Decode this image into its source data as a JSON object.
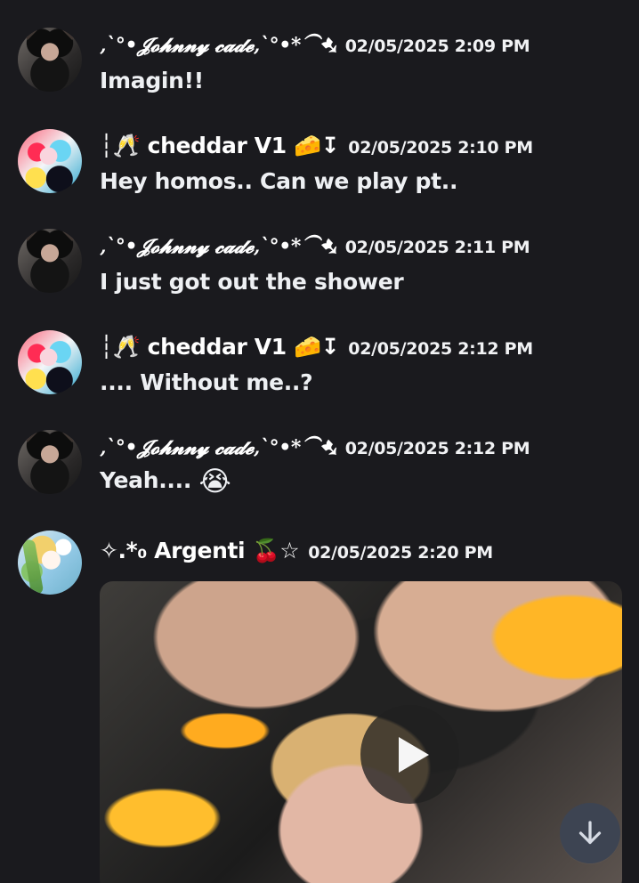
{
  "messages": [
    {
      "username": "‚`°•𝓙𝓸𝓱𝓷𝓷𝔂 𝓬𝓪𝓭𝓮‚`°•*⁀➷",
      "timestamp": "02/05/2025 2:09 PM",
      "text": "Imagin!!",
      "emoji": ""
    },
    {
      "username": "┆🥂 cheddar V1 🧀↧",
      "timestamp": "02/05/2025 2:10 PM",
      "text": "Hey homos.. Can we play pt..",
      "emoji": ""
    },
    {
      "username": "‚`°•𝓙𝓸𝓱𝓷𝓷𝔂 𝓬𝓪𝓭𝓮‚`°•*⁀➷",
      "timestamp": "02/05/2025 2:11 PM",
      "text": "I just got out the shower",
      "emoji": ""
    },
    {
      "username": "┆🥂 cheddar V1 🧀↧",
      "timestamp": "02/05/2025 2:12 PM",
      "text": ".... Without me..?",
      "emoji": ""
    },
    {
      "username": "‚`°•𝓙𝓸𝓱𝓷𝓷𝔂 𝓬𝓪𝓭𝓮‚`°•*⁀➷",
      "timestamp": "02/05/2025 2:12 PM",
      "text": "Yeah....",
      "emoji": "😭"
    },
    {
      "username": "✧.*₀ Argenti 🍒☆",
      "timestamp": "02/05/2025 2:20 PM",
      "text": "",
      "emoji": ""
    }
  ],
  "icons": {
    "play": "play-icon",
    "scroll": "arrow-down-icon"
  },
  "colors": {
    "background": "#1a1a1e",
    "text": "#f2f3f5",
    "scroll_button": "#3d4452"
  }
}
